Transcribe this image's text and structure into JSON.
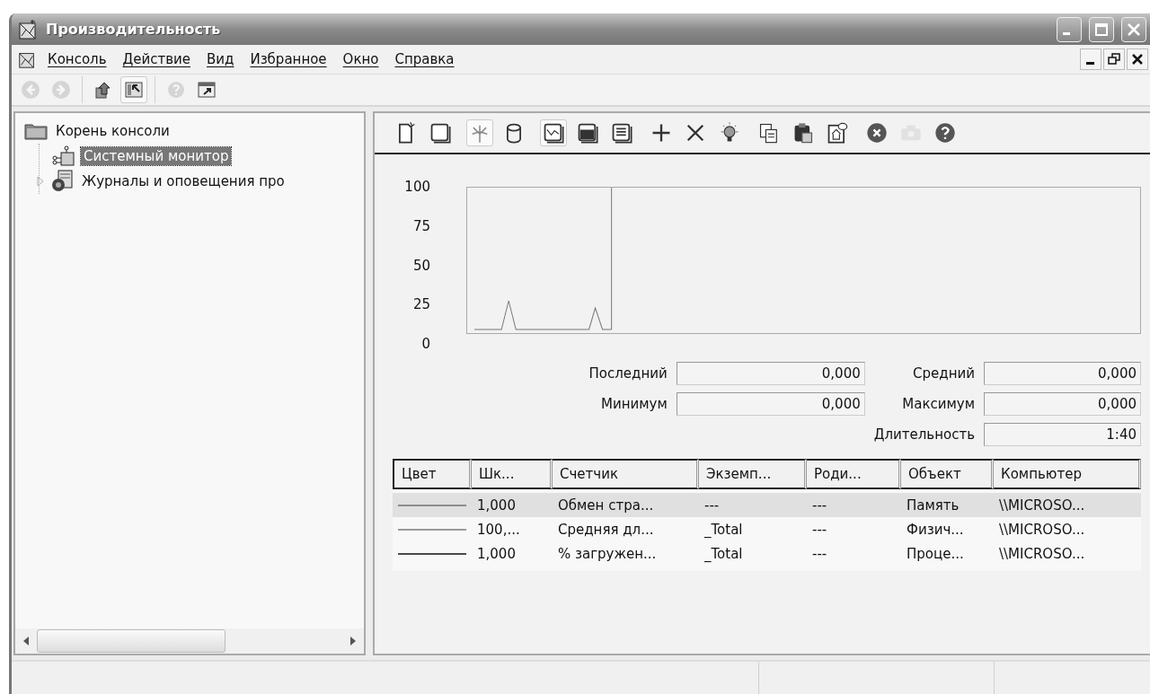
{
  "window": {
    "title": "Производительность"
  },
  "menu": [
    {
      "label": "Консоль"
    },
    {
      "label": "Действие"
    },
    {
      "label": "Вид"
    },
    {
      "label": "Избранное"
    },
    {
      "label": "Окно"
    },
    {
      "label": "Справка"
    }
  ],
  "toolbar": {
    "groups": [
      [
        {
          "kind": "back",
          "disabled": true,
          "pressed": false
        },
        {
          "kind": "forward",
          "disabled": true,
          "pressed": false
        }
      ],
      [
        {
          "kind": "up",
          "disabled": false,
          "pressed": false
        },
        {
          "kind": "tree",
          "disabled": false,
          "pressed": true
        }
      ],
      [
        {
          "kind": "help",
          "disabled": true,
          "pressed": false
        },
        {
          "kind": "new-window",
          "disabled": false,
          "pressed": false
        }
      ]
    ]
  },
  "tree": [
    {
      "label": "Корень консоли",
      "kind": "folder",
      "selected": false,
      "children": [
        {
          "label": "Системный монитор",
          "kind": "monitor",
          "selected": true
        },
        {
          "label": "Журналы и оповещения про",
          "kind": "logs",
          "selected": false,
          "expanded": false
        }
      ]
    }
  ],
  "monitor": {
    "toolbar": {
      "groups": [
        [
          {
            "kind": "new",
            "pressed": false,
            "disabled": false
          },
          {
            "kind": "clear",
            "pressed": false,
            "disabled": false
          }
        ],
        [
          {
            "kind": "freeze",
            "pressed": true,
            "disabled": false
          },
          {
            "kind": "database",
            "pressed": false,
            "disabled": false
          }
        ],
        [
          {
            "kind": "graph",
            "pressed": true,
            "disabled": false
          },
          {
            "kind": "histogram",
            "pressed": false,
            "disabled": false
          },
          {
            "kind": "report",
            "pressed": false,
            "disabled": false
          }
        ],
        [
          {
            "kind": "add",
            "pressed": false,
            "disabled": false
          },
          {
            "kind": "delete",
            "pressed": false,
            "disabled": false
          },
          {
            "kind": "highlight",
            "pressed": false,
            "disabled": false
          }
        ],
        [
          {
            "kind": "copy",
            "pressed": false,
            "disabled": false
          },
          {
            "kind": "paste",
            "pressed": false,
            "disabled": false
          },
          {
            "kind": "properties",
            "pressed": false,
            "disabled": false
          }
        ],
        [
          {
            "kind": "stop",
            "pressed": false,
            "disabled": false
          },
          {
            "kind": "camera",
            "pressed": false,
            "disabled": true
          },
          {
            "kind": "help",
            "pressed": false,
            "disabled": false
          }
        ]
      ]
    },
    "graph": {
      "yticks": [
        "100",
        "75",
        "50",
        "25",
        "0"
      ]
    },
    "stats": [
      {
        "label": "Последний",
        "value": "0,000"
      },
      {
        "label": "Средний",
        "value": "0,000"
      },
      {
        "label": "Минимум",
        "value": "0,000"
      },
      {
        "label": "Максимум",
        "value": "0,000"
      },
      {
        "label": "Длительность",
        "value": "1:40"
      }
    ],
    "counters": {
      "columns": [
        "Цвет",
        "Шк...",
        "Счетчик",
        "Экземп...",
        "Роди...",
        "Объект",
        "Компьютер"
      ],
      "rows": [
        {
          "color": "#8c8c8c",
          "selected": true,
          "scale": "1,000",
          "counter": "Обмен стра...",
          "instance": "---",
          "parent": "---",
          "object": "Память",
          "computer": "\\\\MICROSO..."
        },
        {
          "color": "#9a9a9a",
          "selected": false,
          "scale": "100,...",
          "counter": "Средняя дл...",
          "instance": "_Total",
          "parent": "---",
          "object": "Физич...",
          "computer": "\\\\MICROSO..."
        },
        {
          "color": "#4a4a4a",
          "selected": false,
          "scale": "1,000",
          "counter": "% загружен...",
          "instance": "_Total",
          "parent": "---",
          "object": "Проце...",
          "computer": "\\\\MICROSO..."
        }
      ]
    }
  }
}
